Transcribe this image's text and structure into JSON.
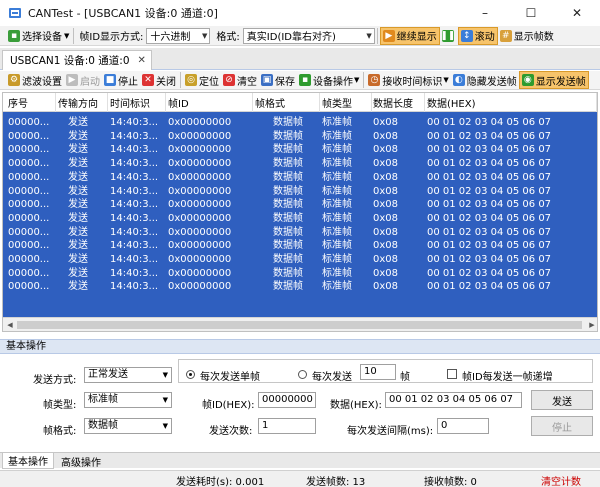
{
  "window": {
    "title": "CANTest - [USBCAN1 设备:0 通道:0]",
    "minimize": "–",
    "maximize": "☐",
    "close": "✕"
  },
  "toolbar1": {
    "select_device": "选择设备",
    "id_format_label": "帧ID显示方式:",
    "id_format_value": "十六进制",
    "format_label": "格式:",
    "format_value": "真实ID(ID靠右对齐)",
    "continue_display": "继续显示",
    "scroll": "滚动",
    "show_frame_count": "显示帧数"
  },
  "doc_tab": {
    "label": "USBCAN1 设备:0 通道:0",
    "close": "✕"
  },
  "toolbar2": {
    "filter": "滤波设置",
    "start": "启动",
    "stop": "停止",
    "close": "关闭",
    "locate": "定位",
    "clear": "清空",
    "save": "保存",
    "device_ops": "设备操作",
    "rx_time_mode": "接收时间标识",
    "hide_send": "隐藏发送帧",
    "show_send": "显示发送帧"
  },
  "grid": {
    "columns": [
      "序号",
      "传输方向",
      "时间标识",
      "帧ID",
      "帧格式",
      "帧类型",
      "数据长度",
      "数据(HEX)"
    ],
    "rows": [
      [
        "00000...",
        "发送",
        "14:40:3...",
        "0x00000000",
        "数据帧",
        "标准帧",
        "0x08",
        "00 01 02 03 04 05 06 07"
      ],
      [
        "00000...",
        "发送",
        "14:40:3...",
        "0x00000000",
        "数据帧",
        "标准帧",
        "0x08",
        "00 01 02 03 04 05 06 07"
      ],
      [
        "00000...",
        "发送",
        "14:40:3...",
        "0x00000000",
        "数据帧",
        "标准帧",
        "0x08",
        "00 01 02 03 04 05 06 07"
      ],
      [
        "00000...",
        "发送",
        "14:40:3...",
        "0x00000000",
        "数据帧",
        "标准帧",
        "0x08",
        "00 01 02 03 04 05 06 07"
      ],
      [
        "00000...",
        "发送",
        "14:40:3...",
        "0x00000000",
        "数据帧",
        "标准帧",
        "0x08",
        "00 01 02 03 04 05 06 07"
      ],
      [
        "00000...",
        "发送",
        "14:40:3...",
        "0x00000000",
        "数据帧",
        "标准帧",
        "0x08",
        "00 01 02 03 04 05 06 07"
      ],
      [
        "00000...",
        "发送",
        "14:40:3...",
        "0x00000000",
        "数据帧",
        "标准帧",
        "0x08",
        "00 01 02 03 04 05 06 07"
      ],
      [
        "00000...",
        "发送",
        "14:40:3...",
        "0x00000000",
        "数据帧",
        "标准帧",
        "0x08",
        "00 01 02 03 04 05 06 07"
      ],
      [
        "00000...",
        "发送",
        "14:40:3...",
        "0x00000000",
        "数据帧",
        "标准帧",
        "0x08",
        "00 01 02 03 04 05 06 07"
      ],
      [
        "00000...",
        "发送",
        "14:40:3...",
        "0x00000000",
        "数据帧",
        "标准帧",
        "0x08",
        "00 01 02 03 04 05 06 07"
      ],
      [
        "00000...",
        "发送",
        "14:40:3...",
        "0x00000000",
        "数据帧",
        "标准帧",
        "0x08",
        "00 01 02 03 04 05 06 07"
      ],
      [
        "00000...",
        "发送",
        "14:40:3...",
        "0x00000000",
        "数据帧",
        "标准帧",
        "0x08",
        "00 01 02 03 04 05 06 07"
      ],
      [
        "00000...",
        "发送",
        "14:40:3...",
        "0x00000000",
        "数据帧",
        "标准帧",
        "0x08",
        "00 01 02 03 04 05 06 07"
      ]
    ]
  },
  "panel": {
    "header": "基本操作",
    "send_mode_label": "发送方式:",
    "send_mode_value": "正常发送",
    "frame_type_label": "帧类型:",
    "frame_type_value": "标准帧",
    "frame_format_label": "帧格式:",
    "frame_format_value": "数据帧",
    "radio_single": "每次发送单帧",
    "radio_multi": "每次发送",
    "multi_count": "10",
    "multi_unit": "帧",
    "id_increment": "帧ID每发送一帧递增",
    "frame_id_label": "帧ID(HEX):",
    "frame_id_value": "00000000",
    "data_label": "数据(HEX):",
    "data_value": "00 01 02 03 04 05 06 07",
    "send_count_label": "发送次数:",
    "send_count_value": "1",
    "interval_label": "每次发送间隔(ms):",
    "interval_value": "0",
    "send_button": "发送",
    "stop_button": "停止"
  },
  "bottom_tabs": [
    "基本操作",
    "高级操作"
  ],
  "status": {
    "send_time": "发送耗时(s): 0.001",
    "send_frames": "发送帧数: 13",
    "recv_frames": "接收帧数: 0",
    "clear_count": "清空计数"
  },
  "colors": {
    "grid_selection": "#2f5fbf",
    "highlight": "#f7c46b",
    "clear_count": "#cc0000"
  }
}
